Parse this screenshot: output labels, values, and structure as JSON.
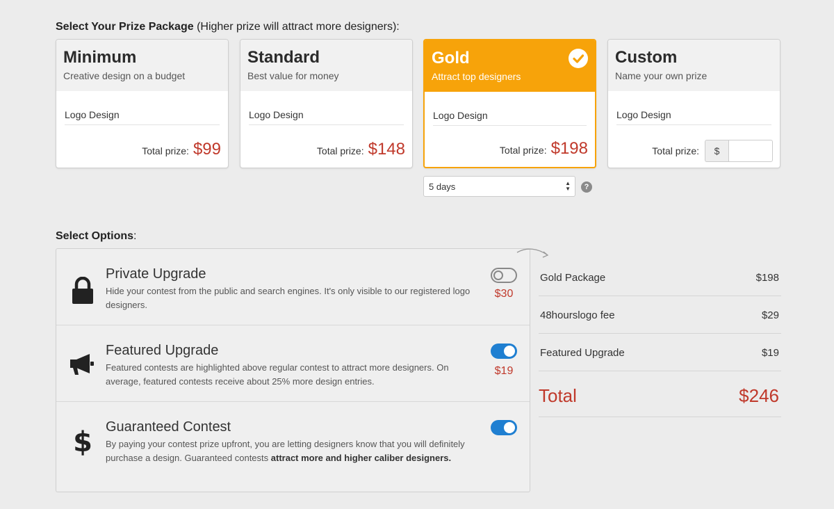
{
  "prize_section": {
    "title_bold": "Select Your Prize Package",
    "title_rest": " (Higher prize will attract more designers):"
  },
  "packages": [
    {
      "name": "Minimum",
      "subtitle": "Creative design on a budget",
      "item": "Logo Design",
      "total_label": "Total prize:",
      "amount": "$99",
      "selected": false
    },
    {
      "name": "Standard",
      "subtitle": "Best value for money",
      "item": "Logo Design",
      "total_label": "Total prize:",
      "amount": "$148",
      "selected": false
    },
    {
      "name": "Gold",
      "subtitle": "Attract top designers",
      "item": "Logo Design",
      "total_label": "Total prize:",
      "amount": "$198",
      "selected": true
    },
    {
      "name": "Custom",
      "subtitle": "Name your own prize",
      "item": "Logo Design",
      "total_label": "Total prize:",
      "currency": "$",
      "input_value": "",
      "selected": false
    }
  ],
  "duration": {
    "selected": "5 days"
  },
  "options_section": {
    "title_bold": "Select Options",
    "title_rest": ":"
  },
  "options": [
    {
      "icon": "lock-icon",
      "title": "Private Upgrade",
      "description": "Hide your contest from the public and search engines. It's only visible to our registered logo designers.",
      "price": "$30",
      "enabled": false
    },
    {
      "icon": "megaphone-icon",
      "title": "Featured Upgrade",
      "description": "Featured contests are highlighted above regular contest to attract more designers. On average, featured contests receive about 25% more design entries.",
      "price": "$19",
      "enabled": true
    },
    {
      "icon": "dollar-icon",
      "title": "Guaranteed Contest",
      "description_plain": "By paying your contest prize upfront, you are letting designers know that you will definitely purchase a design. Guaranteed contests ",
      "description_bold": "attract more and higher caliber designers.",
      "enabled": true
    }
  ],
  "summary": {
    "rows": [
      {
        "label": "Gold Package",
        "value": "$198"
      },
      {
        "label": "48hourslogo fee",
        "value": "$29"
      },
      {
        "label": "Featured Upgrade",
        "value": "$19"
      }
    ],
    "total_label": "Total",
    "total_value": "$246"
  },
  "colors": {
    "accent_gold": "#f7a30a",
    "price_red": "#c0392b",
    "toggle_blue": "#1f7fd1"
  }
}
